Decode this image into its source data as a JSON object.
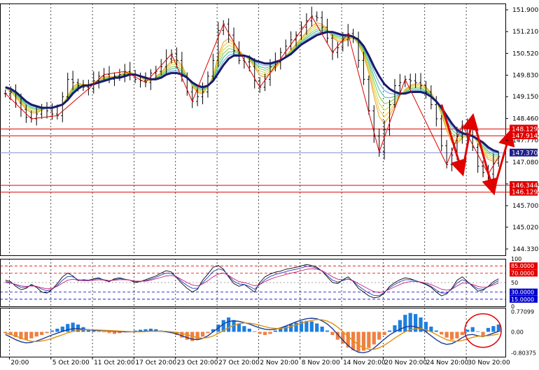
{
  "chart_data": {
    "type": "line",
    "colors": {
      "background": "#ffffff",
      "price_bars": "#000000",
      "zigzag": "#e00000",
      "level_lines": "#e00000",
      "current_price": "#1e1e8c",
      "ma_main": "#1a1a6e",
      "ma_ribbon": [
        "#e6a020",
        "#f0c030",
        "#c8d840",
        "#80c850",
        "#40b890",
        "#50a0d0"
      ],
      "rsi_line_1": "#000000",
      "rsi_line_2": "#1e3cc8",
      "rsi_line_3": "#c81e6e",
      "macd_positive": "#1e7ee0",
      "macd_negative": "#f08040",
      "macd_line": "#1e3c96",
      "signal_line": "#e0900a",
      "highlight_circle": "#e00000",
      "label_red": "#e00000",
      "label_blue": "#0000cc",
      "label_dark": "#1e1e8c"
    },
    "price_panel": {
      "y_ticks": [
        144.33,
        145.02,
        145.7,
        146.39,
        147.08,
        147.77,
        148.46,
        149.15,
        149.83,
        150.52,
        151.21,
        151.9
      ],
      "ylim": [
        144.13,
        152.1
      ],
      "price_labels": {
        "resistance_high": "148.129",
        "resistance_low": "147.914",
        "current": "147.370",
        "support_high": "146.344",
        "support_low": "146.129"
      },
      "levels": [
        148.129,
        147.914,
        146.344,
        146.129
      ],
      "current_price": 147.37,
      "series": [
        {
          "values": [
            149.25,
            149.3,
            148.95,
            148.75,
            148.5,
            148.45,
            148.6,
            148.8,
            148.7,
            148.6,
            148.55,
            149.15,
            149.7,
            149.6,
            149.5,
            149.45,
            149.4,
            149.65,
            149.8,
            149.85,
            149.7,
            149.8,
            149.85,
            149.95,
            149.85,
            149.7,
            149.65,
            149.6,
            149.9,
            149.95,
            150.1,
            150.35,
            150.5,
            150.3,
            149.8,
            149.3,
            149.0,
            149.15,
            149.3,
            149.8,
            150.3,
            151.25,
            151.45,
            151.1,
            150.6,
            150.3,
            150.25,
            150.1,
            149.65,
            149.45,
            149.7,
            150.1,
            150.25,
            150.55,
            150.75,
            150.95,
            151.1,
            151.35,
            151.55,
            151.7,
            151.65,
            151.35,
            151.0,
            150.55,
            150.7,
            150.95,
            151.15,
            151.0,
            150.3,
            149.7,
            148.7,
            147.9,
            147.4,
            148.1,
            148.9,
            149.5,
            149.6,
            149.7,
            149.65,
            149.6,
            149.5,
            149.3,
            148.9,
            148.45,
            147.6,
            147.0,
            147.3,
            147.9,
            148.25,
            147.9,
            147.55,
            146.95,
            146.75,
            146.7,
            147.05,
            147.25
          ]
        },
        {
          "values": [
            149.4,
            149.3,
            149.1,
            148.9,
            148.7,
            148.6,
            148.6,
            148.7,
            148.8,
            148.8,
            148.8,
            148.9,
            149.2,
            149.5,
            149.6,
            149.55,
            149.55,
            149.6,
            149.7,
            149.8,
            149.8,
            149.8,
            149.85,
            149.95,
            149.95,
            149.85,
            149.75,
            149.65,
            149.65,
            149.8,
            149.95,
            150.15,
            150.35,
            150.4,
            150.2,
            149.8,
            149.45,
            149.25,
            149.2,
            149.45,
            149.85,
            150.55,
            151.0,
            151.1,
            150.9,
            150.65,
            150.45,
            150.3,
            150.05,
            149.75,
            149.7,
            149.85,
            150.0,
            150.25,
            150.45,
            150.65,
            150.85,
            151.05,
            151.25,
            151.45,
            151.55,
            151.5,
            151.3,
            151.0,
            150.85,
            150.85,
            150.95,
            151.0,
            150.8,
            150.4,
            149.8,
            149.0,
            148.3,
            148.1,
            148.4,
            148.8,
            149.15,
            149.4,
            149.55,
            149.6,
            149.6,
            149.5,
            149.3,
            149.0,
            148.55,
            148.0,
            147.6,
            147.6,
            147.8,
            148.0,
            147.95,
            147.65,
            147.35,
            147.1,
            147.05,
            147.1
          ]
        },
        {
          "values": [
            149.45,
            149.4,
            149.3,
            149.15,
            149.0,
            148.9,
            148.85,
            148.8,
            148.8,
            148.8,
            148.85,
            148.9,
            149.05,
            149.25,
            149.4,
            149.5,
            149.5,
            149.55,
            149.6,
            149.65,
            149.7,
            149.75,
            149.75,
            149.8,
            149.85,
            149.85,
            149.8,
            149.75,
            149.7,
            149.7,
            149.75,
            149.85,
            149.9,
            149.9,
            149.85,
            149.75,
            149.6,
            149.5,
            149.45,
            149.5,
            149.65,
            149.9,
            150.15,
            150.35,
            150.45,
            150.45,
            150.45,
            150.4,
            150.3,
            150.25,
            150.2,
            150.2,
            150.25,
            150.3,
            150.4,
            150.5,
            150.65,
            150.8,
            150.9,
            151.0,
            151.1,
            151.15,
            151.2,
            151.2,
            151.15,
            151.1,
            151.1,
            151.05,
            150.95,
            150.75,
            150.45,
            150.1,
            149.8,
            149.55,
            149.4,
            149.3,
            149.25,
            149.25,
            149.3,
            149.3,
            149.3,
            149.25,
            149.15,
            149.0,
            148.8,
            148.55,
            148.3,
            148.1,
            148.0,
            147.95,
            147.9,
            147.8,
            147.7,
            147.55,
            147.45,
            147.4
          ]
        }
      ]
    },
    "oscillator_panel": {
      "ylim": [
        0,
        100
      ],
      "y_ticks": [
        100,
        50,
        0
      ],
      "levels": [
        85,
        70,
        30,
        15
      ],
      "level_labels": {
        "l85": "85.0000",
        "l70": "70.0000",
        "l30": "30.0000",
        "l15": "15.0000"
      },
      "tick_labels": {
        "t100": "100",
        "t50": "50",
        "t0": "0"
      },
      "series": [
        {
          "values": [
            55,
            52,
            42,
            35,
            38,
            46,
            40,
            30,
            28,
            36,
            48,
            62,
            70,
            64,
            54,
            56,
            55,
            58,
            60,
            55,
            52,
            58,
            60,
            57,
            55,
            50,
            52,
            56,
            60,
            64,
            70,
            75,
            72,
            60,
            48,
            38,
            30,
            36,
            55,
            68,
            82,
            86,
            78,
            62,
            48,
            42,
            46,
            38,
            30,
            50,
            62,
            68,
            72,
            74,
            78,
            80,
            82,
            85,
            88,
            86,
            82,
            74,
            62,
            50,
            48,
            56,
            62,
            52,
            38,
            30,
            22,
            18,
            20,
            28,
            42,
            50,
            56,
            60,
            58,
            54,
            50,
            46,
            40,
            30,
            22,
            26,
            38,
            55,
            62,
            52,
            42,
            32,
            34,
            42,
            52,
            58
          ]
        },
        {
          "values": [
            52,
            50,
            45,
            40,
            40,
            44,
            42,
            36,
            33,
            36,
            44,
            55,
            63,
            62,
            56,
            55,
            55,
            57,
            58,
            56,
            54,
            56,
            58,
            57,
            55,
            52,
            52,
            54,
            57,
            61,
            66,
            70,
            69,
            62,
            52,
            44,
            38,
            38,
            50,
            61,
            73,
            79,
            76,
            64,
            53,
            47,
            46,
            42,
            36,
            46,
            56,
            63,
            67,
            70,
            73,
            76,
            78,
            81,
            84,
            83,
            80,
            74,
            65,
            55,
            51,
            54,
            58,
            53,
            43,
            35,
            28,
            23,
            23,
            29,
            39,
            46,
            52,
            56,
            56,
            54,
            51,
            47,
            42,
            34,
            28,
            28,
            36,
            49,
            56,
            51,
            44,
            37,
            36,
            41,
            48,
            54
          ]
        },
        {
          "values": [
            50,
            49,
            46,
            43,
            42,
            43,
            42,
            39,
            37,
            38,
            42,
            49,
            55,
            57,
            55,
            54,
            54,
            55,
            56,
            55,
            54,
            55,
            56,
            56,
            55,
            53,
            53,
            53,
            55,
            58,
            61,
            64,
            65,
            62,
            56,
            50,
            45,
            43,
            47,
            54,
            62,
            68,
            70,
            65,
            58,
            52,
            50,
            47,
            43,
            46,
            52,
            57,
            61,
            64,
            67,
            70,
            72,
            75,
            78,
            79,
            78,
            75,
            69,
            62,
            57,
            56,
            57,
            54,
            48,
            42,
            36,
            31,
            29,
            31,
            36,
            41,
            46,
            50,
            52,
            52,
            51,
            49,
            46,
            41,
            36,
            34,
            36,
            43,
            49,
            49,
            46,
            42,
            40,
            41,
            45,
            49
          ]
        }
      ]
    },
    "macd_panel": {
      "ylim": [
        -0.95,
        0.92
      ],
      "y_ticks": [
        0.77099,
        0.0,
        -0.80375
      ],
      "tick_labels": {
        "t_top": "0.77099",
        "t_mid": "0.00",
        "t_bot": "-0.80375"
      },
      "histogram": [
        -0.05,
        -0.12,
        -0.2,
        -0.28,
        -0.3,
        -0.25,
        -0.18,
        -0.12,
        -0.05,
        0.05,
        0.12,
        0.2,
        0.3,
        0.35,
        0.28,
        0.18,
        0.1,
        0.05,
        0.02,
        -0.02,
        -0.05,
        -0.08,
        -0.05,
        -0.02,
        0.02,
        0.05,
        0.08,
        0.1,
        0.12,
        0.1,
        0.05,
        0.0,
        -0.05,
        -0.12,
        -0.22,
        -0.3,
        -0.35,
        -0.3,
        -0.18,
        -0.05,
        0.1,
        0.28,
        0.45,
        0.55,
        0.45,
        0.32,
        0.22,
        0.12,
        0.02,
        -0.08,
        -0.12,
        -0.08,
        0.05,
        0.15,
        0.22,
        0.3,
        0.35,
        0.4,
        0.42,
        0.4,
        0.32,
        0.2,
        0.05,
        -0.12,
        -0.3,
        -0.45,
        -0.6,
        -0.7,
        -0.75,
        -0.72,
        -0.62,
        -0.48,
        -0.3,
        -0.12,
        0.05,
        0.25,
        0.45,
        0.65,
        0.72,
        0.68,
        0.55,
        0.38,
        0.2,
        0.05,
        -0.1,
        -0.22,
        -0.3,
        -0.25,
        -0.12,
        0.08,
        0.18,
        0.02,
        -0.15,
        0.15,
        0.22,
        0.28
      ],
      "macd_line": [
        -0.1,
        -0.2,
        -0.3,
        -0.38,
        -0.42,
        -0.4,
        -0.35,
        -0.28,
        -0.2,
        -0.12,
        -0.05,
        0.02,
        0.08,
        0.12,
        0.12,
        0.1,
        0.08,
        0.06,
        0.05,
        0.04,
        0.03,
        0.02,
        0.01,
        0.0,
        0.0,
        0.0,
        0.01,
        0.02,
        0.03,
        0.03,
        0.02,
        0.0,
        -0.03,
        -0.08,
        -0.15,
        -0.22,
        -0.28,
        -0.3,
        -0.25,
        -0.15,
        0.0,
        0.15,
        0.3,
        0.4,
        0.42,
        0.4,
        0.35,
        0.3,
        0.22,
        0.15,
        0.1,
        0.08,
        0.1,
        0.15,
        0.22,
        0.3,
        0.38,
        0.45,
        0.5,
        0.52,
        0.5,
        0.42,
        0.3,
        0.12,
        -0.1,
        -0.32,
        -0.52,
        -0.68,
        -0.78,
        -0.8,
        -0.75,
        -0.62,
        -0.45,
        -0.28,
        -0.12,
        0.0,
        0.1,
        0.18,
        0.22,
        0.2,
        0.12,
        0.0,
        -0.15,
        -0.3,
        -0.42,
        -0.48,
        -0.45,
        -0.35,
        -0.22,
        -0.12,
        -0.1,
        -0.15,
        -0.18,
        -0.12,
        -0.05,
        0.02
      ],
      "signal_line": [
        -0.05,
        -0.1,
        -0.16,
        -0.24,
        -0.31,
        -0.36,
        -0.37,
        -0.35,
        -0.31,
        -0.25,
        -0.18,
        -0.11,
        -0.04,
        0.02,
        0.06,
        0.08,
        0.08,
        0.08,
        0.07,
        0.06,
        0.05,
        0.04,
        0.03,
        0.02,
        0.01,
        0.0,
        0.0,
        0.01,
        0.02,
        0.02,
        0.02,
        0.02,
        0.0,
        -0.02,
        -0.06,
        -0.11,
        -0.17,
        -0.22,
        -0.24,
        -0.22,
        -0.16,
        -0.06,
        0.05,
        0.16,
        0.25,
        0.31,
        0.34,
        0.33,
        0.3,
        0.25,
        0.2,
        0.15,
        0.13,
        0.13,
        0.16,
        0.2,
        0.26,
        0.33,
        0.39,
        0.44,
        0.47,
        0.46,
        0.41,
        0.32,
        0.18,
        0.01,
        -0.17,
        -0.34,
        -0.49,
        -0.61,
        -0.67,
        -0.67,
        -0.61,
        -0.51,
        -0.38,
        -0.24,
        -0.11,
        0.0,
        0.08,
        0.12,
        0.12,
        0.08,
        0.0,
        -0.1,
        -0.21,
        -0.3,
        -0.35,
        -0.36,
        -0.33,
        -0.27,
        -0.21,
        -0.17,
        -0.16,
        -0.15,
        -0.12,
        -0.08
      ]
    },
    "x_axis": {
      "labels": [
        "20:00",
        "5 Oct 20:00",
        "11 Oct 20:00",
        "17 Oct 20:00",
        "23 Oct 20:00",
        "27 Oct 20:00",
        "2 Nov 20:00",
        "8 Nov 20:00",
        "14 Nov 20:00",
        "20 Nov 20:00",
        "24 Nov 20:00",
        "30 Nov 20:00"
      ],
      "label_indices": [
        0,
        8,
        16,
        24,
        32,
        40,
        48,
        56,
        64,
        72,
        80,
        88
      ]
    },
    "grid": true
  }
}
